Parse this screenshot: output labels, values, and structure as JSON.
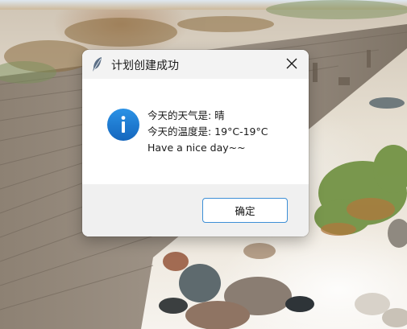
{
  "dialog": {
    "title": "计划创建成功",
    "message_lines": [
      "今天的天气是: 晴",
      "今天的温度是: 19°C-19°C",
      "Have a nice day~~"
    ],
    "ok_label": "确定"
  },
  "icons": {
    "app": "feather-icon",
    "close": "close-icon",
    "info": "info-icon"
  },
  "colors": {
    "info_blue": "#1a7ad4",
    "button_border": "#3d8fd6",
    "titlebar_bg": "#f3f3f3",
    "footer_bg": "#f0f0f0"
  }
}
